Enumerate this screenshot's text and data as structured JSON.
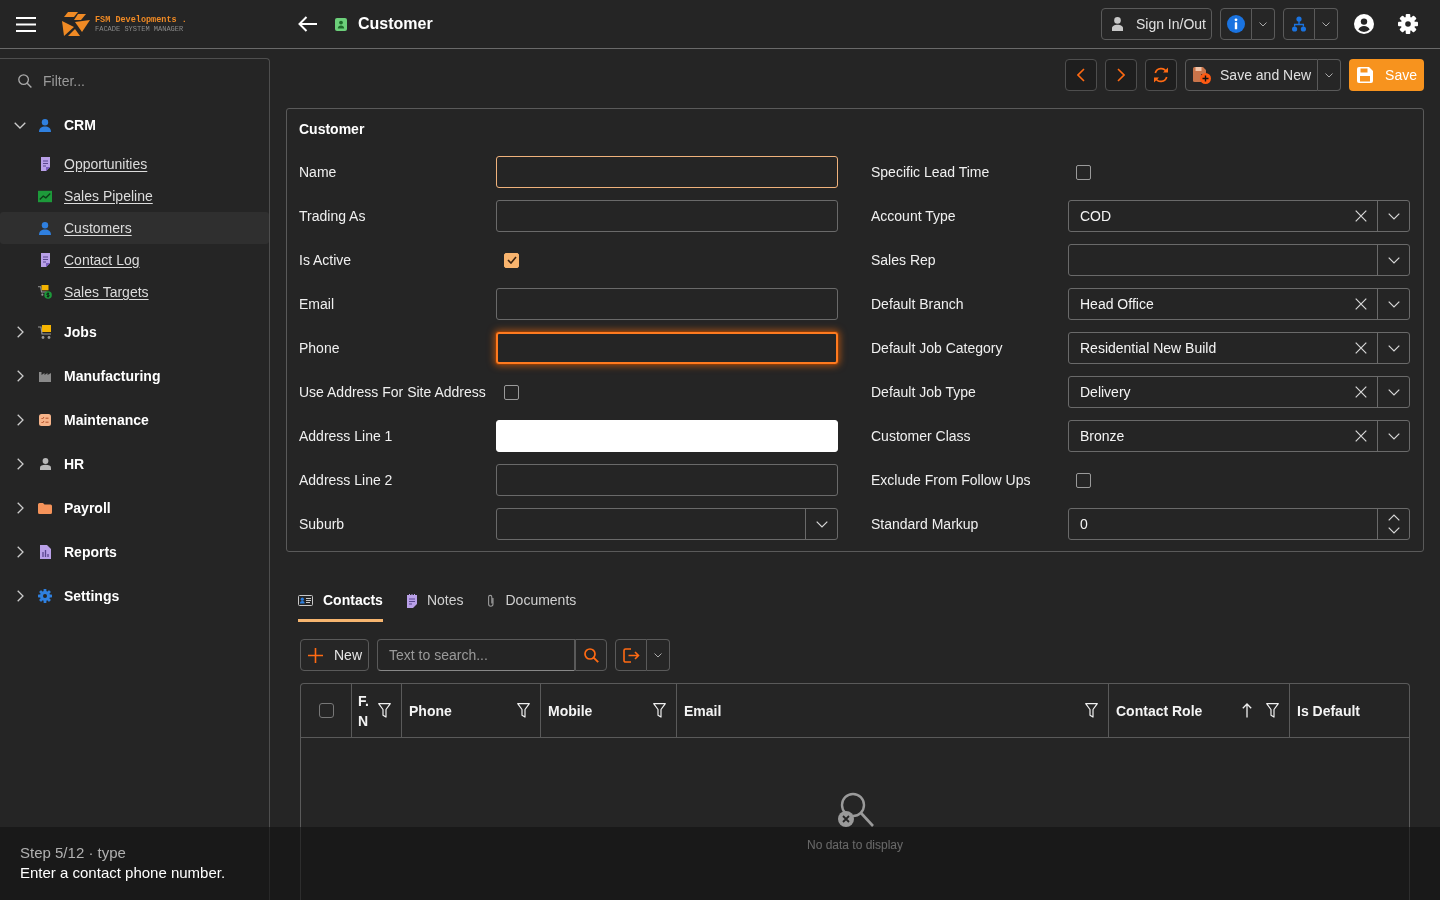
{
  "header": {
    "logo_name": "FSM Developments .",
    "logo_tagline": "FACADE SYSTEM MANAGER",
    "title": "Customer",
    "sign_in": "Sign In/Out"
  },
  "sidebar": {
    "filter_placeholder": "Filter...",
    "items": [
      {
        "label": "CRM",
        "expanded": true,
        "children": [
          {
            "label": "Opportunities",
            "selected": false
          },
          {
            "label": "Sales Pipeline",
            "selected": false
          },
          {
            "label": "Customers",
            "selected": true
          },
          {
            "label": "Contact Log",
            "selected": false
          },
          {
            "label": "Sales Targets",
            "selected": false
          }
        ]
      },
      {
        "label": "Jobs",
        "expanded": false
      },
      {
        "label": "Manufacturing",
        "expanded": false
      },
      {
        "label": "Maintenance",
        "expanded": false
      },
      {
        "label": "HR",
        "expanded": false
      },
      {
        "label": "Payroll",
        "expanded": false
      },
      {
        "label": "Reports",
        "expanded": false
      },
      {
        "label": "Settings",
        "expanded": false
      }
    ]
  },
  "toolbar": {
    "save_and_new": "Save and New",
    "save": "Save"
  },
  "form": {
    "title": "Customer",
    "left": [
      {
        "kind": "text",
        "label": "Name",
        "hovered": true
      },
      {
        "kind": "text",
        "label": "Trading As"
      },
      {
        "kind": "checkbox",
        "label": "Is Active",
        "checked": true
      },
      {
        "kind": "text",
        "label": "Email"
      },
      {
        "kind": "text",
        "label": "Phone",
        "focused": true
      },
      {
        "kind": "checkbox",
        "label": "Use Address For Site Address",
        "checked": false
      },
      {
        "kind": "text",
        "label": "Address Line 1",
        "autofilled": true
      },
      {
        "kind": "text",
        "label": "Address Line 2"
      },
      {
        "kind": "combo",
        "label": "Suburb"
      }
    ],
    "right": [
      {
        "kind": "checkbox",
        "label": "Specific Lead Time",
        "checked": false
      },
      {
        "kind": "combo",
        "label": "Account Type",
        "value": "COD"
      },
      {
        "kind": "combo",
        "label": "Sales Rep"
      },
      {
        "kind": "combo",
        "label": "Default Branch",
        "value": "Head Office"
      },
      {
        "kind": "combo",
        "label": "Default Job Category",
        "value": "Residential New Build"
      },
      {
        "kind": "combo",
        "label": "Default Job Type",
        "value": "Delivery"
      },
      {
        "kind": "combo",
        "label": "Customer Class",
        "value": "Bronze"
      },
      {
        "kind": "checkbox",
        "label": "Exclude From Follow Ups",
        "checked": false
      },
      {
        "kind": "spin",
        "label": "Standard Markup",
        "value": "0"
      }
    ]
  },
  "tabs": [
    {
      "label": "Contacts",
      "selected": true
    },
    {
      "label": "Notes",
      "selected": false
    },
    {
      "label": "Documents",
      "selected": false
    }
  ],
  "grid": {
    "new_button": "New",
    "search_placeholder": "Text to search...",
    "select_all_checked": false,
    "columns": [
      {
        "label": "F. N",
        "filter": true
      },
      {
        "label": "Phone",
        "filter": true
      },
      {
        "label": "Mobile",
        "filter": true
      },
      {
        "label": "Email",
        "filter": true
      },
      {
        "label": "Contact Role",
        "filter": true,
        "sorted_ascending": true
      },
      {
        "label": "Is Default",
        "filter": false
      }
    ],
    "empty_text": "No data to display"
  },
  "tutorial": {
    "step": "Step 5/12 · type",
    "instruction": "Enter a contact phone number."
  }
}
